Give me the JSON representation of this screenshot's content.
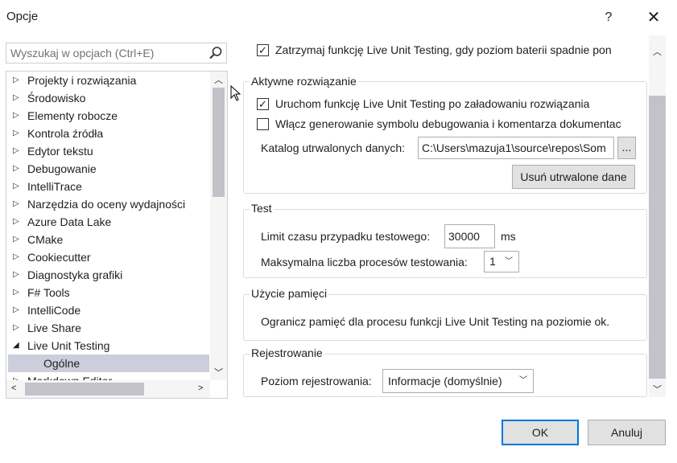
{
  "window": {
    "title": "Opcje",
    "help_label": "?",
    "close_label": "✕"
  },
  "search": {
    "placeholder": "Wyszukaj w opcjach (Ctrl+E)"
  },
  "tree": {
    "items": [
      {
        "label": "Projekty i rozwiązania",
        "expanded": false
      },
      {
        "label": "Środowisko",
        "expanded": false
      },
      {
        "label": "Elementy robocze",
        "expanded": false
      },
      {
        "label": "Kontrola źródła",
        "expanded": false
      },
      {
        "label": "Edytor tekstu",
        "expanded": false
      },
      {
        "label": "Debugowanie",
        "expanded": false
      },
      {
        "label": "IntelliTrace",
        "expanded": false
      },
      {
        "label": "Narzędzia do oceny wydajności",
        "expanded": false
      },
      {
        "label": "Azure Data Lake",
        "expanded": false
      },
      {
        "label": "CMake",
        "expanded": false
      },
      {
        "label": "Cookiecutter",
        "expanded": false
      },
      {
        "label": "Diagnostyka grafiki",
        "expanded": false
      },
      {
        "label": "F# Tools",
        "expanded": false
      },
      {
        "label": "IntelliCode",
        "expanded": false
      },
      {
        "label": "Live Share",
        "expanded": false
      },
      {
        "label": "Live Unit Testing",
        "expanded": true
      },
      {
        "label": "Ogólne",
        "child": true,
        "selected": true
      },
      {
        "label": "Markdown Editor",
        "expanded": false
      }
    ],
    "collapsed_glyph": "▷",
    "expanded_glyph": "◢"
  },
  "options": {
    "battery_checkbox": {
      "label": "Zatrzymaj funkcję Live Unit Testing, gdy poziom baterii spadnie pon",
      "checked": true
    },
    "active_solution": {
      "title": "Aktywne rozwiązanie",
      "auto_start": {
        "label": "Uruchom funkcję Live Unit Testing po załadowaniu rozwiązania",
        "checked": true
      },
      "debug_symbols": {
        "label": "Włącz generowanie symbolu debugowania i komentarza dokumentac",
        "checked": false
      },
      "persisted_dir_label": "Katalog utrwalonych danych:",
      "persisted_dir_value": "C:\\Users\\mazuja1\\source\\repos\\Som",
      "browse_label": "...",
      "delete_button": "Usuń utrwalone dane"
    },
    "test": {
      "title": "Test",
      "timeout_label": "Limit czasu przypadku testowego:",
      "timeout_value": "30000",
      "timeout_unit": "ms",
      "max_processes_label": "Maksymalna liczba procesów testowania:",
      "max_processes_value": "1"
    },
    "memory": {
      "title": "Użycie pamięci",
      "text": "Ogranicz pamięć dla procesu funkcji Live Unit Testing na poziomie ok."
    },
    "logging": {
      "title": "Rejestrowanie",
      "level_label": "Poziom rejestrowania:",
      "level_value": "Informacje (domyślnie)"
    }
  },
  "footer": {
    "ok": "OK",
    "cancel": "Anuluj"
  },
  "colors": {
    "selection": "#cccedb",
    "accent": "#0078d7",
    "scrollbar_thumb": "#c2c3c9"
  }
}
